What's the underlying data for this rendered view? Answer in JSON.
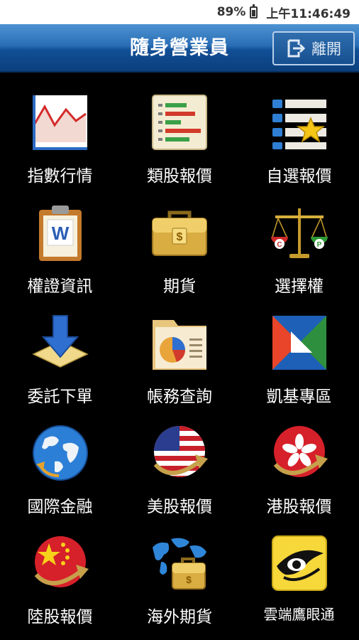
{
  "status_bar": {
    "battery": "89%",
    "time": "上午11:46:49"
  },
  "header": {
    "title": "隨身營業員",
    "logout_label": "離開"
  },
  "menu": [
    {
      "label": "指數行情",
      "icon": "line-chart-icon"
    },
    {
      "label": "類股報價",
      "icon": "bar-list-icon"
    },
    {
      "label": "自選報價",
      "icon": "star-list-icon"
    },
    {
      "label": "權證資訊",
      "icon": "clipboard-document-icon"
    },
    {
      "label": "期貨",
      "icon": "briefcase-dollar-icon"
    },
    {
      "label": "選擇權",
      "icon": "balance-scale-icon"
    },
    {
      "label": "委託下單",
      "icon": "download-arrow-icon"
    },
    {
      "label": "帳務查詢",
      "icon": "folder-pie-chart-icon"
    },
    {
      "label": "凱基專區",
      "icon": "kgi-logo-icon"
    },
    {
      "label": "國際金融",
      "icon": "globe-icon"
    },
    {
      "label": "美股報價",
      "icon": "us-flag-icon"
    },
    {
      "label": "港股報價",
      "icon": "hk-flag-icon"
    },
    {
      "label": "陸股報價",
      "icon": "china-flag-icon"
    },
    {
      "label": "海外期貨",
      "icon": "world-briefcase-icon"
    },
    {
      "label": "雲端鷹眼通",
      "icon": "eagle-eye-icon"
    }
  ]
}
